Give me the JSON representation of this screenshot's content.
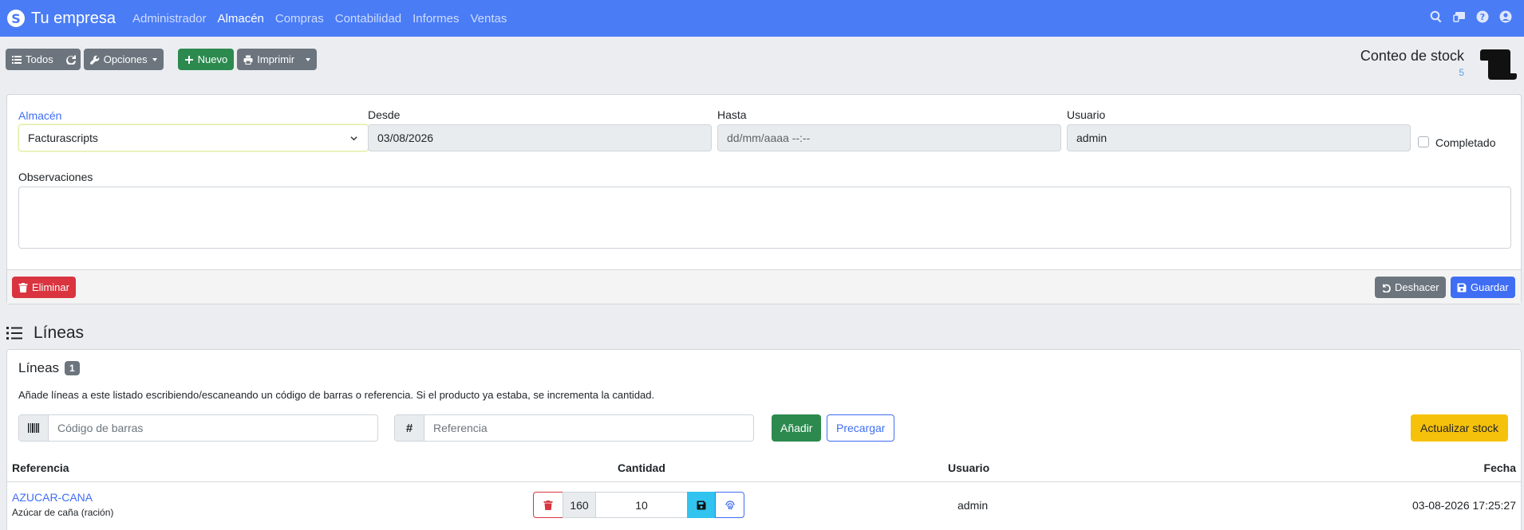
{
  "navbar": {
    "brand": "Tu empresa",
    "links": [
      "Administrador",
      "Almacén",
      "Compras",
      "Contabilidad",
      "Informes",
      "Ventas"
    ],
    "active": "Almacén",
    "icons": [
      "search-icon",
      "swap-icon",
      "help-icon",
      "user-icon"
    ]
  },
  "toolbar": {
    "all_label": "Todos",
    "options_label": "Opciones",
    "new_label": "Nuevo",
    "print_label": "Imprimir"
  },
  "page": {
    "title": "Conteo de stock",
    "count": "5"
  },
  "form": {
    "almacen_label": "Almacén",
    "almacen_value": "Facturascripts",
    "desde_label": "Desde",
    "desde_value": "03/08/2026",
    "hasta_label": "Hasta",
    "hasta_placeholder": "dd/mm/aaaa --:--",
    "usuario_label": "Usuario",
    "usuario_value": "admin",
    "completado_label": "Completado",
    "completado_checked": false,
    "observaciones_label": "Observaciones",
    "observaciones_value": ""
  },
  "form_footer": {
    "delete_label": "Eliminar",
    "undo_label": "Deshacer",
    "save_label": "Guardar"
  },
  "lines_section": {
    "heading": "Líneas",
    "card_title": "Líneas",
    "count": "1",
    "description": "Añade líneas a este listado escribiendo/escaneando un código de barras o referencia. Si el producto ya estaba, se incrementa la cantidad.",
    "barcode_placeholder": "Código de barras",
    "reference_placeholder": "Referencia",
    "add_label": "Añadir",
    "preload_label": "Precargar",
    "update_stock_label": "Actualizar stock"
  },
  "table": {
    "headers": {
      "referencia": "Referencia",
      "cantidad": "Cantidad",
      "usuario": "Usuario",
      "fecha": "Fecha"
    },
    "rows": [
      {
        "referencia": "AZUCAR-CANA",
        "descripcion": "Azúcar de caña (ración)",
        "stock": "160",
        "cantidad": "10",
        "usuario": "admin",
        "fecha": "03-08-2026 17:25:27"
      }
    ]
  },
  "colors": {
    "navbar": "#4a7cf6",
    "primary": "#3f6ef5",
    "success": "#2c8a4f",
    "danger": "#d9343f",
    "warning": "#f6c10b",
    "secondary": "#6c757d",
    "info": "#32c3ef"
  }
}
